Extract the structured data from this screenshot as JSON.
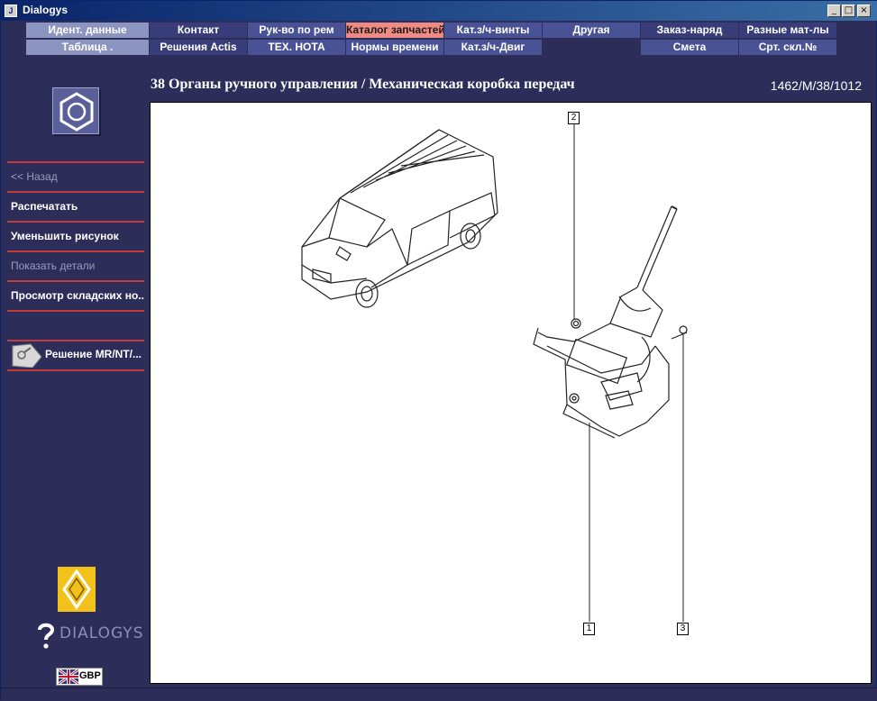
{
  "window": {
    "title": "Dialogys"
  },
  "menu": {
    "row1": [
      {
        "label": "Идент. данные",
        "style": "light"
      },
      {
        "label": "Контакт",
        "style": "dark"
      },
      {
        "label": "Рук-во по рем",
        "style": "mid"
      },
      {
        "label": "Каталог запчастей",
        "style": "active"
      },
      {
        "label": "Кат.з/ч-винты",
        "style": "mid"
      },
      {
        "label": "Другая",
        "style": "mid"
      },
      {
        "label": "Заказ-наряд",
        "style": "dark"
      },
      {
        "label": "Разные мат-лы",
        "style": "dark"
      }
    ],
    "row2": [
      {
        "label": "Таблица .",
        "style": "light"
      },
      {
        "label": "Решения Actis",
        "style": "dark"
      },
      {
        "label": "ТЕХ. НОТА",
        "style": "mid"
      },
      {
        "label": "Нормы времени",
        "style": "mid"
      },
      {
        "label": "Кат.з/ч-Двиг",
        "style": "mid"
      },
      {
        "label": "",
        "style": "none"
      },
      {
        "label": "Смета",
        "style": "mid"
      },
      {
        "label": "Срт. скл.№",
        "style": "mid"
      }
    ]
  },
  "sidebar": {
    "items": [
      {
        "label": "<< Назад",
        "enabled": false
      },
      {
        "label": "Распечатать",
        "enabled": true
      },
      {
        "label": "Уменьшить рисунок",
        "enabled": true
      },
      {
        "label": "Показать детали",
        "enabled": false
      },
      {
        "label": "Просмотр складских но...",
        "enabled": true
      },
      {
        "label": "",
        "enabled": false
      }
    ],
    "solution_label": "Решение MR/NT/...",
    "brand_text": "DIALOGYS",
    "currency": "GBP"
  },
  "header": {
    "title": "38 Органы ручного управления / Механическая коробка передач",
    "reference": "1462/M/38/1012"
  },
  "diagram": {
    "callouts": [
      "2",
      "1",
      "3"
    ]
  },
  "colors": {
    "background": "#2d2d5a",
    "menu_active": "#f08a84",
    "divider": "#c43a3a"
  }
}
